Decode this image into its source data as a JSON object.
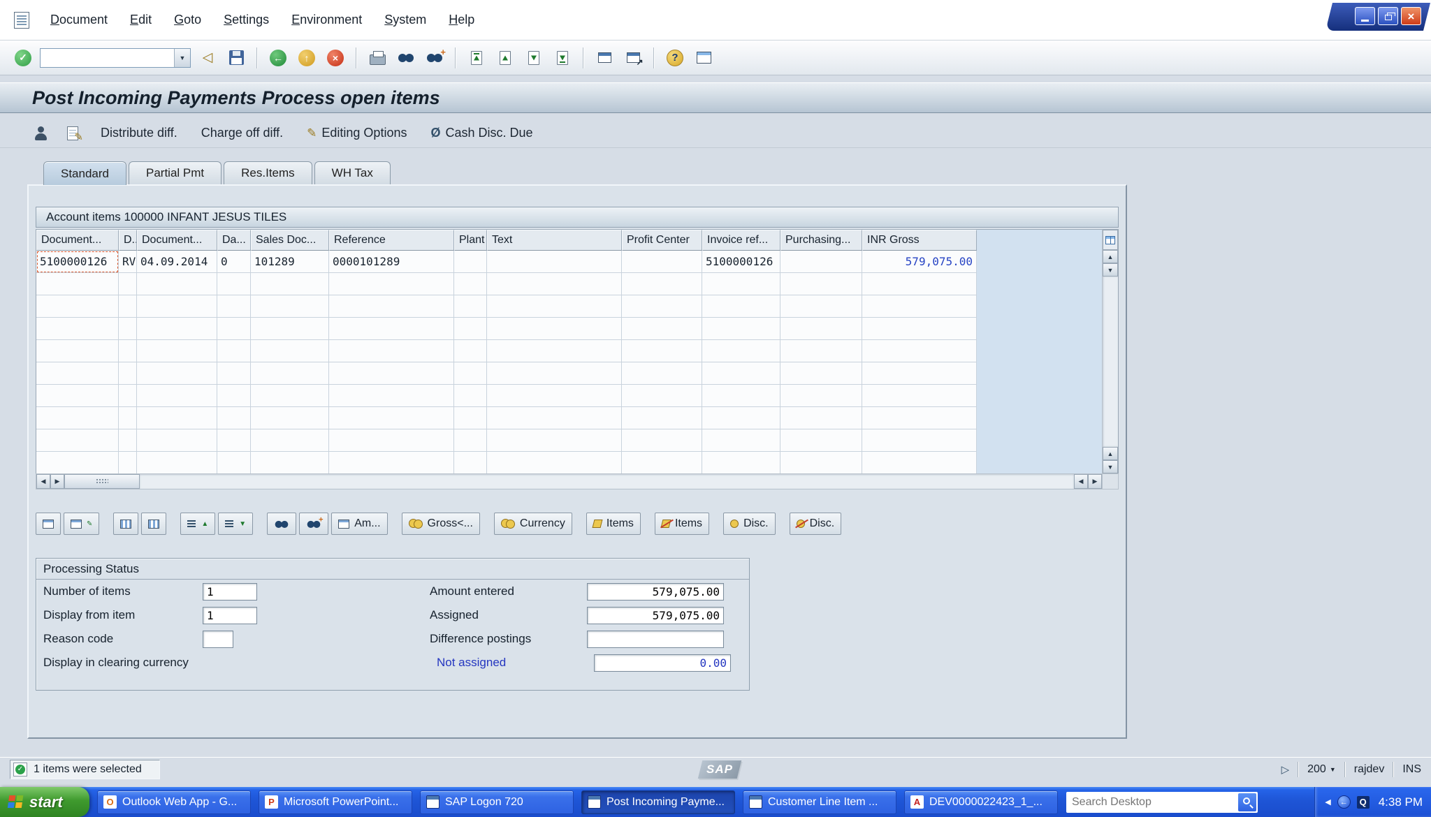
{
  "icons": {
    "check": "✓",
    "back_triangle": "◁",
    "back_arrow": "←",
    "exit_arrow": "↑",
    "cancel_x": "×",
    "close_x": "×",
    "help_q": "?",
    "dropdown": "▼",
    "up": "▲",
    "down": "▼",
    "left": "◀",
    "right": "▶",
    "pencil": "✎",
    "slashed_circle": "Ø",
    "play": "▷",
    "find_plus": "+",
    "shortcut_arrow": "↗",
    "sort_asc": "▲",
    "sort_desc": "▼"
  },
  "menu": {
    "items": [
      "Document",
      "Edit",
      "Goto",
      "Settings",
      "Environment",
      "System",
      "Help"
    ]
  },
  "toolbar": {
    "command_value": ""
  },
  "screen": {
    "title": "Post Incoming Payments Process open items"
  },
  "app_toolbar": {
    "buttons": [
      {
        "label": "Distribute diff."
      },
      {
        "label": "Charge off diff."
      },
      {
        "label": "Editing Options"
      },
      {
        "label": "Cash Disc. Due"
      }
    ]
  },
  "tabs": [
    {
      "label": "Standard",
      "active": true
    },
    {
      "label": "Partial Pmt",
      "active": false
    },
    {
      "label": "Res.Items",
      "active": false
    },
    {
      "label": "WH Tax",
      "active": false
    }
  ],
  "account_items": {
    "caption": "Account items 100000 INFANT JESUS TILES"
  },
  "table": {
    "columns": [
      "Document...",
      "D...",
      "Document...",
      "Da...",
      "Sales Doc...",
      "Reference",
      "Plant",
      "Text",
      "Profit Center",
      "Invoice ref...",
      "Purchasing...",
      "INR Gross"
    ],
    "rows": [
      {
        "document_number": "5100000126",
        "doc_type": "RV",
        "document_date": "04.09.2014",
        "days": "0",
        "sales_doc": "101289",
        "reference": "0000101289",
        "plant": "",
        "text": "",
        "profit_center": "",
        "invoice_ref": "5100000126",
        "purchasing": "",
        "inr_gross": "579,075.00"
      }
    ]
  },
  "item_toolbar": {
    "buttons": [
      {
        "label": "Am..."
      },
      {
        "label": "Gross<..."
      },
      {
        "label": "Currency"
      },
      {
        "label": "Items"
      },
      {
        "label": "Items"
      },
      {
        "label": "Disc."
      },
      {
        "label": "Disc."
      }
    ]
  },
  "processing_status": {
    "title": "Processing Status",
    "number_of_items": {
      "label": "Number of items",
      "value": "1"
    },
    "display_from_item": {
      "label": "Display from item",
      "value": "1"
    },
    "reason_code": {
      "label": "Reason code",
      "value": ""
    },
    "clearing_currency": {
      "label": "Display in clearing currency"
    },
    "amount_entered": {
      "label": "Amount entered",
      "value": "579,075.00"
    },
    "assigned": {
      "label": "Assigned",
      "value": "579,075.00"
    },
    "difference_postings": {
      "label": "Difference postings",
      "value": ""
    },
    "not_assigned": {
      "label": "Not assigned",
      "value": "0.00"
    }
  },
  "status_bar": {
    "message": "1 items were selected",
    "sap_logo": "SAP",
    "page_size": "200",
    "user": "rajdev",
    "mode": "INS"
  },
  "taskbar": {
    "start_label": "start",
    "buttons": [
      {
        "label": "Outlook Web App - G...",
        "icon": "O",
        "active": false
      },
      {
        "label": "Microsoft PowerPoint...",
        "icon": "P",
        "active": false
      },
      {
        "label": "SAP Logon 720",
        "icon": "",
        "active": false
      },
      {
        "label": "Post Incoming Payme...",
        "icon": "",
        "active": true
      },
      {
        "label": "Customer Line Item ...",
        "icon": "",
        "active": false
      },
      {
        "label": "DEV0000022423_1_...",
        "icon": "A",
        "active": false
      }
    ],
    "search_placeholder": "Search Desktop",
    "time": "4:38 PM"
  },
  "colors": {
    "taskbar_blue": "#2458d8",
    "start_green": "#3f9a2e",
    "amount_blue": "#2436c0",
    "selection_red": "#d8542a",
    "title_gradient_bottom": "#b6c5d3"
  }
}
